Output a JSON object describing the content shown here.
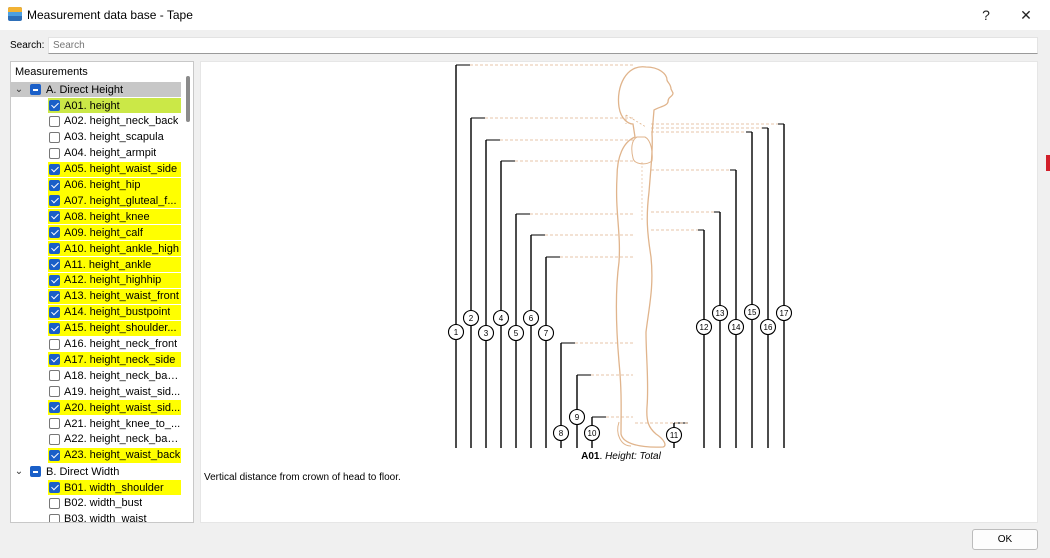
{
  "window": {
    "title": "Measurement data base - Tape",
    "help_label": "?",
    "close_label": "✕"
  },
  "search": {
    "label": "Search:",
    "placeholder": "Search"
  },
  "tree": {
    "header": "Measurements",
    "groups": [
      {
        "label": "A. Direct Height",
        "expanded": true
      },
      {
        "label": "B. Direct Width",
        "expanded": true
      }
    ],
    "items": [
      {
        "label": "A01. height",
        "checked": true,
        "highlight": "selected"
      },
      {
        "label": "A02. height_neck_back",
        "checked": false,
        "highlight": "none"
      },
      {
        "label": "A03. height_scapula",
        "checked": false,
        "highlight": "none"
      },
      {
        "label": "A04. height_armpit",
        "checked": false,
        "highlight": "none"
      },
      {
        "label": "A05. height_waist_side",
        "checked": true,
        "highlight": "yellow"
      },
      {
        "label": "A06. height_hip",
        "checked": true,
        "highlight": "yellow"
      },
      {
        "label": "A07. height_gluteal_f...",
        "checked": true,
        "highlight": "yellow"
      },
      {
        "label": "A08. height_knee",
        "checked": true,
        "highlight": "yellow"
      },
      {
        "label": "A09. height_calf",
        "checked": true,
        "highlight": "yellow"
      },
      {
        "label": "A10. height_ankle_high",
        "checked": true,
        "highlight": "yellow"
      },
      {
        "label": "A11. height_ankle",
        "checked": true,
        "highlight": "yellow"
      },
      {
        "label": "A12. height_highhip",
        "checked": true,
        "highlight": "yellow"
      },
      {
        "label": "A13. height_waist_front",
        "checked": true,
        "highlight": "yellow"
      },
      {
        "label": "A14. height_bustpoint",
        "checked": true,
        "highlight": "yellow"
      },
      {
        "label": "A15. height_shoulder...",
        "checked": true,
        "highlight": "yellow"
      },
      {
        "label": "A16. height_neck_front",
        "checked": false,
        "highlight": "none"
      },
      {
        "label": "A17. height_neck_side",
        "checked": true,
        "highlight": "yellow"
      },
      {
        "label": "A18. height_neck_bac...",
        "checked": false,
        "highlight": "none"
      },
      {
        "label": "A19. height_waist_sid...",
        "checked": false,
        "highlight": "none"
      },
      {
        "label": "A20. height_waist_sid...",
        "checked": true,
        "highlight": "yellow"
      },
      {
        "label": "A21. height_knee_to_...",
        "checked": false,
        "highlight": "none"
      },
      {
        "label": "A22. height_neck_bac...",
        "checked": false,
        "highlight": "none"
      },
      {
        "label": "A23. height_waist_back",
        "checked": true,
        "highlight": "yellow"
      },
      {
        "label": "B01. width_shoulder",
        "checked": true,
        "highlight": "yellow"
      },
      {
        "label": "B02. width_bust",
        "checked": false,
        "highlight": "none"
      },
      {
        "label": "B03. width_waist",
        "checked": false,
        "highlight": "none"
      }
    ]
  },
  "diagram": {
    "marker_labels": [
      "1",
      "2",
      "3",
      "4",
      "5",
      "6",
      "7",
      "8",
      "9",
      "10",
      "11",
      "12",
      "13",
      "14",
      "15",
      "16",
      "17"
    ],
    "caption_code": "A01",
    "caption_sep": ". ",
    "caption_name": "Height: Total",
    "description": "Vertical distance from crown of head to floor.",
    "body_color": "#e0b48c",
    "line_color": "#000000"
  },
  "footer": {
    "ok_label": "OK"
  }
}
